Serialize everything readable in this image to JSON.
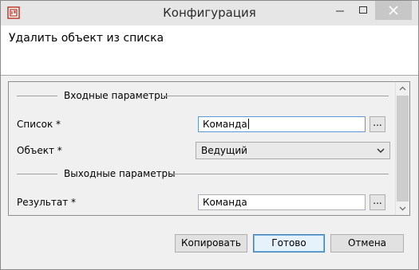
{
  "window": {
    "title": "Конфигурация",
    "header_title": "Удалить объект из списка"
  },
  "input_group": {
    "label": "Входные параметры",
    "list_label": "Список *",
    "list_value": "Команда",
    "object_label": "Объект *",
    "object_value": "Ведущий",
    "browse_label": "..."
  },
  "output_group": {
    "label": "Выходные параметры",
    "result_label": "Результат *",
    "result_value": "Команда",
    "browse_label": "..."
  },
  "buttons": {
    "copy": "Копировать",
    "done": "Готово",
    "cancel": "Отмена"
  },
  "colors": {
    "accent": "#5b9bd5",
    "default_button_border": "#3c7fb1",
    "app_icon": "#c0392b"
  },
  "icons": [
    "app-icon",
    "minimize-icon",
    "maximize-icon",
    "close-icon",
    "scroll-up-icon",
    "scroll-down-icon",
    "chevron-down-icon"
  ]
}
